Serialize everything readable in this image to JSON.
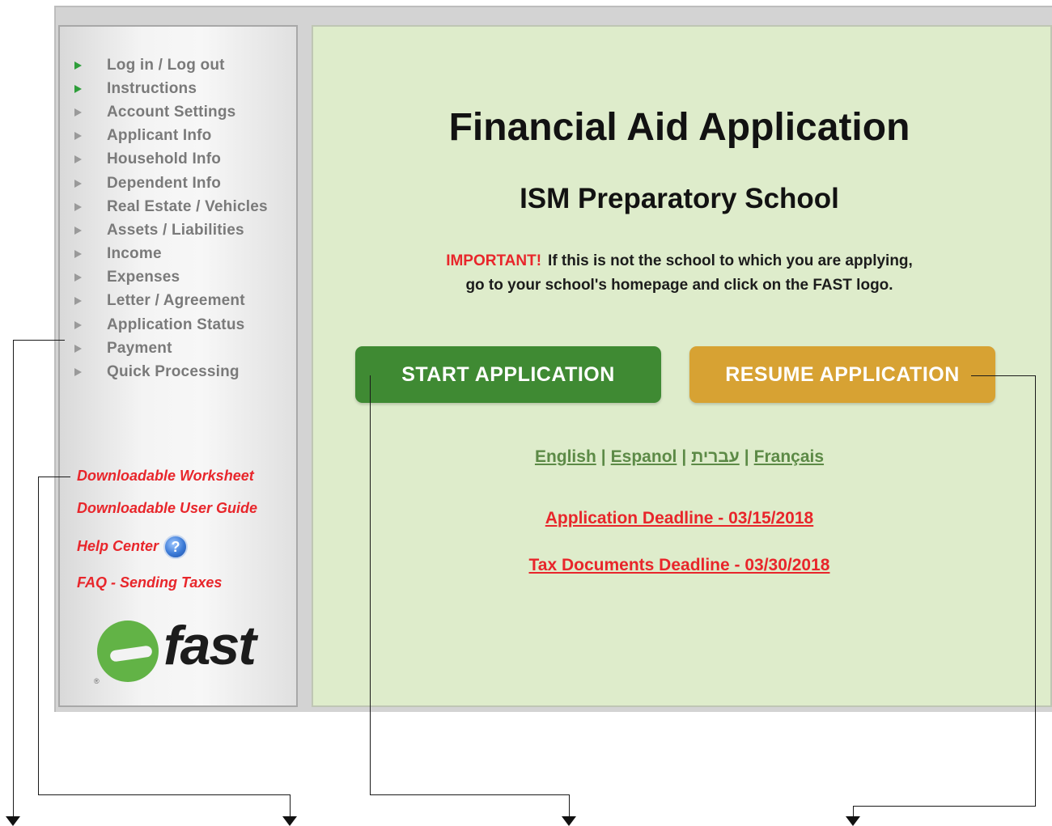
{
  "sidebar": {
    "nav_items": [
      {
        "label": "Log in / Log out",
        "active": true
      },
      {
        "label": "Instructions",
        "active": true
      },
      {
        "label": "Account Settings",
        "active": false
      },
      {
        "label": "Applicant Info",
        "active": false
      },
      {
        "label": "Household Info",
        "active": false
      },
      {
        "label": "Dependent Info",
        "active": false
      },
      {
        "label": "Real Estate / Vehicles",
        "active": false
      },
      {
        "label": "Assets / Liabilities",
        "active": false
      },
      {
        "label": "Income",
        "active": false
      },
      {
        "label": "Expenses",
        "active": false
      },
      {
        "label": "Letter / Agreement",
        "active": false
      },
      {
        "label": "Application Status",
        "active": false
      },
      {
        "label": "Payment",
        "active": false
      },
      {
        "label": "Quick Processing",
        "active": false
      }
    ],
    "links": {
      "worksheet": "Downloadable Worksheet",
      "user_guide": "Downloadable User Guide",
      "help_center": "Help Center",
      "faq": "FAQ - Sending Taxes"
    },
    "help_icon_glyph": "?",
    "logo": {
      "word": "fast",
      "reg": "®"
    }
  },
  "main": {
    "title": "Financial Aid Application",
    "school": "ISM Preparatory School",
    "notice": {
      "important": "IMPORTANT!",
      "line1": "If this is not the school to which you are applying,",
      "line2": "go to your school's homepage and click on the FAST logo."
    },
    "buttons": {
      "start": "START APPLICATION",
      "resume": "RESUME APPLICATION"
    },
    "languages": [
      "English",
      "Espanol",
      "עברית",
      "Français"
    ],
    "language_separator": "|",
    "deadlines": {
      "application": "Application Deadline - 03/15/2018",
      "tax": "Tax Documents Deadline - 03/30/2018"
    }
  },
  "colors": {
    "accent_red": "#e8262b",
    "start_green": "#3f8a33",
    "resume_gold": "#d7a233",
    "main_bg": "#deeccb",
    "active_arrow": "#2e9e3a"
  }
}
